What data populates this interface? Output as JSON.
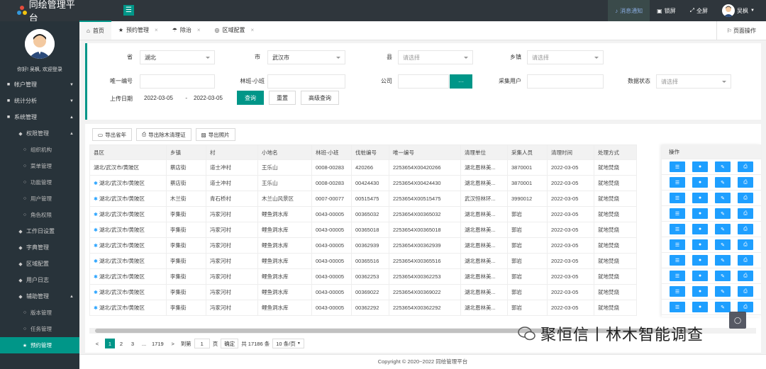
{
  "app": {
    "title": "同绘管理平台"
  },
  "topbar": {
    "notice": "消息通知",
    "lock": "锁屏",
    "fullscreen": "全屏",
    "user": "吴枫"
  },
  "sidebar": {
    "greeting": "你好! 吴枫, 欢迎登录",
    "items": [
      {
        "label": "帐户管理",
        "level": 1,
        "arrow": "▼"
      },
      {
        "label": "统计分析",
        "level": 1,
        "arrow": "▼"
      },
      {
        "label": "系统管理",
        "level": 1,
        "arrow": "▲"
      },
      {
        "label": "权限管理",
        "level": 2,
        "arrow": "▲"
      },
      {
        "label": "组织机构",
        "level": 3
      },
      {
        "label": "菜单管理",
        "level": 3
      },
      {
        "label": "功能管理",
        "level": 3
      },
      {
        "label": "用户管理",
        "level": 3
      },
      {
        "label": "角色权限",
        "level": 3
      },
      {
        "label": "工作日设置",
        "level": 2
      },
      {
        "label": "字典管理",
        "level": 2
      },
      {
        "label": "区域配置",
        "level": 2
      },
      {
        "label": "用户日志",
        "level": 2
      },
      {
        "label": "辅助管理",
        "level": 2,
        "arrow": "▲"
      },
      {
        "label": "版本管理",
        "level": 3
      },
      {
        "label": "任务管理",
        "level": 3
      },
      {
        "label": "预约管理",
        "level": 3,
        "selected": true
      }
    ]
  },
  "tabs": {
    "home": "首页",
    "items": [
      "预约管理",
      "除治",
      "区域配置"
    ],
    "page_ops": "页面操作"
  },
  "filters": {
    "province_label": "省",
    "province_value": "湖北",
    "city_label": "市",
    "city_value": "武汉市",
    "county_label": "县",
    "county_placeholder": "请选择",
    "town_label": "乡镇",
    "town_placeholder": "请选择",
    "unique_label": "唯一编号",
    "forest_label": "林班-小班",
    "company_label": "公司",
    "collector_label": "采集用户",
    "status_label": "数据状态",
    "status_placeholder": "请选择",
    "upload_label": "上传日期",
    "date_from": "2022-03-05",
    "date_sep": "-",
    "date_to": "2022-03-05",
    "query_btn": "查询",
    "reset_btn": "重置",
    "advanced_btn": "高级查询",
    "company_btn": "···"
  },
  "toolbar": {
    "export_year": "导出省年",
    "export_certificate": "导出除木清理证",
    "export_photos": "导出照片"
  },
  "table": {
    "columns": [
      "县区",
      "乡镇",
      "村",
      "小地名",
      "林班-小班",
      "伐桩编号",
      "唯一编号",
      "清理单位",
      "采集人员",
      "清理时间",
      "处理方式"
    ],
    "ops_header": "操作",
    "rows": [
      {
        "mark": false,
        "cells": [
          "湖北/武汉市/黄陂区",
          "蔡店街",
          "道士冲村",
          "王乐山",
          "0008-00283",
          "420266",
          "2253654X00420266",
          "湖北恩林美...",
          "3870001",
          "2022-03-05",
          "就地焚烧"
        ]
      },
      {
        "mark": true,
        "cells": [
          "湖北/武汉市/黄陂区",
          "蔡店街",
          "道士冲村",
          "王乐山",
          "0008-00283",
          "00424430",
          "2253654X00424430",
          "湖北恩林美...",
          "3870001",
          "2022-03-05",
          "就地焚烧"
        ]
      },
      {
        "mark": true,
        "cells": [
          "湖北/武汉市/黄陂区",
          "木兰街",
          "青石桥村",
          "木兰山风景区",
          "0007-00077",
          "00515475",
          "2253654X00515475",
          "武汉恒林环...",
          "3990012",
          "2022-03-05",
          "就地焚烧"
        ]
      },
      {
        "mark": true,
        "cells": [
          "湖北/武汉市/黄陂区",
          "李集街",
          "冯家河村",
          "鲤鱼洞水库",
          "0043-00005",
          "00365032",
          "2253654X00365032",
          "湖北恩林美...",
          "郭岩",
          "2022-03-05",
          "就地焚烧"
        ]
      },
      {
        "mark": true,
        "cells": [
          "湖北/武汉市/黄陂区",
          "李集街",
          "冯家河村",
          "鲤鱼洞水库",
          "0043-00005",
          "00365018",
          "2253654X00365018",
          "湖北恩林美...",
          "郭岩",
          "2022-03-05",
          "就地焚烧"
        ]
      },
      {
        "mark": true,
        "cells": [
          "湖北/武汉市/黄陂区",
          "李集街",
          "冯家河村",
          "鲤鱼洞水库",
          "0043-00005",
          "00362939",
          "2253654X00362939",
          "湖北恩林美...",
          "郭岩",
          "2022-03-05",
          "就地焚烧"
        ]
      },
      {
        "mark": true,
        "cells": [
          "湖北/武汉市/黄陂区",
          "李集街",
          "冯家河村",
          "鲤鱼洞水库",
          "0043-00005",
          "00365516",
          "2253654X00365516",
          "湖北恩林美...",
          "郭岩",
          "2022-03-05",
          "就地焚烧"
        ]
      },
      {
        "mark": true,
        "cells": [
          "湖北/武汉市/黄陂区",
          "李集街",
          "冯家河村",
          "鲤鱼洞水库",
          "0043-00005",
          "00362253",
          "2253654X00362253",
          "湖北恩林美...",
          "郭岩",
          "2022-03-05",
          "就地焚烧"
        ]
      },
      {
        "mark": true,
        "cells": [
          "湖北/武汉市/黄陂区",
          "李集街",
          "冯家河村",
          "鲤鱼洞水库",
          "0043-00005",
          "00369022",
          "2253654X00369022",
          "湖北恩林美...",
          "郭岩",
          "2022-03-05",
          "就地焚烧"
        ]
      },
      {
        "mark": true,
        "cells": [
          "湖北/武汉市/黄陂区",
          "李集街",
          "冯家河村",
          "鲤鱼洞水库",
          "0043-00005",
          "00362292",
          "2253654X00362292",
          "湖北恩林美...",
          "郭岩",
          "2022-03-05",
          "就地焚烧"
        ]
      }
    ]
  },
  "pager": {
    "prev": "<",
    "pages": [
      "1",
      "2",
      "3",
      "...",
      "1719"
    ],
    "next": ">",
    "goto_label": "到第",
    "goto_value": "1",
    "page_unit": "页",
    "confirm": "确定",
    "total": "共 17186 条",
    "per_page": "10 条/页"
  },
  "footer": {
    "copyright": "Copyright © 2020~2022 同绘管理平台"
  },
  "watermark": {
    "text": "聚恒信丨林木智能调查"
  },
  "colors": {
    "accent": "#009688",
    "topbar": "#2f363c",
    "sidebar": "#28333a",
    "op_button": "#1e9fff"
  }
}
